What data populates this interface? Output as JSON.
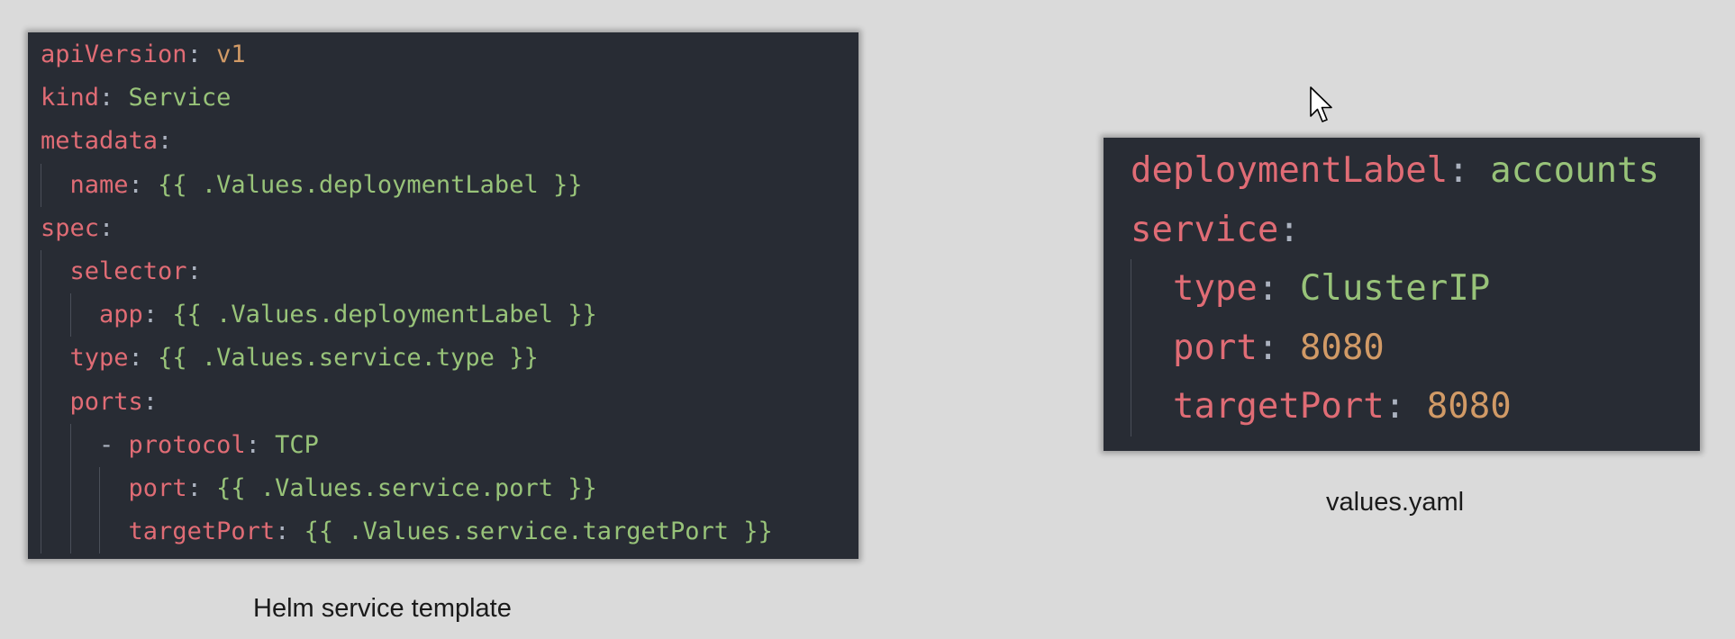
{
  "template_panel": {
    "caption": "Helm service template",
    "lines": [
      {
        "indent": 0,
        "tokens": [
          {
            "t": "apiVersion",
            "c": "key"
          },
          {
            "t": ": ",
            "c": "punc"
          },
          {
            "t": "v1",
            "c": "num"
          }
        ]
      },
      {
        "indent": 0,
        "tokens": [
          {
            "t": "kind",
            "c": "key"
          },
          {
            "t": ": ",
            "c": "punc"
          },
          {
            "t": "Service",
            "c": "str"
          }
        ]
      },
      {
        "indent": 0,
        "tokens": [
          {
            "t": "metadata",
            "c": "key"
          },
          {
            "t": ":",
            "c": "punc"
          }
        ]
      },
      {
        "indent": 1,
        "tokens": [
          {
            "t": "name",
            "c": "key"
          },
          {
            "t": ": ",
            "c": "punc"
          },
          {
            "t": "{{ .Values.deploymentLabel }}",
            "c": "str"
          }
        ]
      },
      {
        "indent": 0,
        "tokens": [
          {
            "t": "spec",
            "c": "key"
          },
          {
            "t": ":",
            "c": "punc"
          }
        ]
      },
      {
        "indent": 1,
        "tokens": [
          {
            "t": "selector",
            "c": "key"
          },
          {
            "t": ":",
            "c": "punc"
          }
        ]
      },
      {
        "indent": 2,
        "tokens": [
          {
            "t": "app",
            "c": "key"
          },
          {
            "t": ": ",
            "c": "punc"
          },
          {
            "t": "{{ .Values.deploymentLabel }}",
            "c": "str"
          }
        ]
      },
      {
        "indent": 1,
        "tokens": [
          {
            "t": "type",
            "c": "key"
          },
          {
            "t": ": ",
            "c": "punc"
          },
          {
            "t": "{{ .Values.service.type }}",
            "c": "str"
          }
        ]
      },
      {
        "indent": 1,
        "tokens": [
          {
            "t": "ports",
            "c": "key"
          },
          {
            "t": ":",
            "c": "punc"
          }
        ]
      },
      {
        "indent": 2,
        "tokens": [
          {
            "t": "- ",
            "c": "punc"
          },
          {
            "t": "protocol",
            "c": "key"
          },
          {
            "t": ": ",
            "c": "punc"
          },
          {
            "t": "TCP",
            "c": "str"
          }
        ]
      },
      {
        "indent": 3,
        "tokens": [
          {
            "t": "port",
            "c": "key"
          },
          {
            "t": ": ",
            "c": "punc"
          },
          {
            "t": "{{ .Values.service.port }}",
            "c": "str"
          }
        ]
      },
      {
        "indent": 3,
        "tokens": [
          {
            "t": "targetPort",
            "c": "key"
          },
          {
            "t": ": ",
            "c": "punc"
          },
          {
            "t": "{{ .Values.service.targetPort }}",
            "c": "str"
          }
        ]
      }
    ]
  },
  "values_panel": {
    "caption": "values.yaml",
    "lines": [
      {
        "indent": 0,
        "tokens": [
          {
            "t": "deploymentLabel",
            "c": "key"
          },
          {
            "t": ": ",
            "c": "punc"
          },
          {
            "t": "accounts",
            "c": "str"
          }
        ]
      },
      {
        "indent": 0,
        "tokens": [
          {
            "t": "service",
            "c": "key"
          },
          {
            "t": ":",
            "c": "punc"
          }
        ]
      },
      {
        "indent": 1,
        "tokens": [
          {
            "t": "type",
            "c": "key"
          },
          {
            "t": ": ",
            "c": "punc"
          },
          {
            "t": "ClusterIP",
            "c": "str"
          }
        ]
      },
      {
        "indent": 1,
        "tokens": [
          {
            "t": "port",
            "c": "key"
          },
          {
            "t": ": ",
            "c": "punc"
          },
          {
            "t": "8080",
            "c": "num"
          }
        ]
      },
      {
        "indent": 1,
        "tokens": [
          {
            "t": "targetPort",
            "c": "key"
          },
          {
            "t": ": ",
            "c": "punc"
          },
          {
            "t": "8080",
            "c": "num"
          }
        ]
      }
    ]
  },
  "colors": {
    "background": "#dadada",
    "editor_background": "#282c34",
    "key": "#e06c75",
    "string": "#98c379",
    "number": "#d19a66",
    "punctuation": "#abb2bf"
  },
  "icons": {
    "cursor": "mouse-pointer-icon"
  }
}
